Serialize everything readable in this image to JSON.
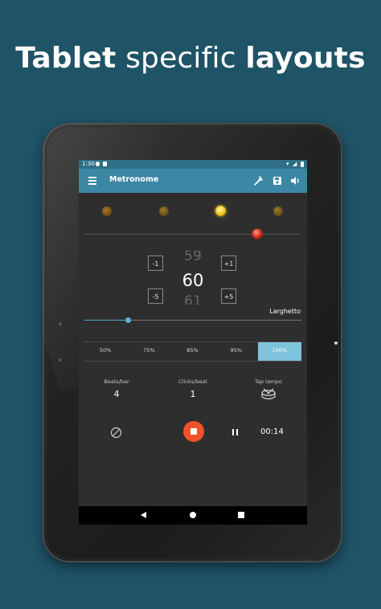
{
  "headline": {
    "bold_1": "Tablet",
    "light": " specific ",
    "bold_2": "layouts"
  },
  "status_bar": {
    "time": "1:30"
  },
  "toolbar": {
    "title": "Metronome"
  },
  "bpm": {
    "previous": "59",
    "current": "60",
    "next": "61"
  },
  "steppers": {
    "minus_one": "-1",
    "plus_one": "+1",
    "minus_five": "-5",
    "plus_five": "+5"
  },
  "tempo": {
    "name": "Larghetto",
    "slider_fraction": 0.2
  },
  "speed_options": [
    {
      "label": "50%"
    },
    {
      "label": "75%"
    },
    {
      "label": "85%"
    },
    {
      "label": "95%"
    },
    {
      "label": "100%",
      "active": true
    }
  ],
  "stats": {
    "beats_label": "Beats/bar",
    "beats_value": "4",
    "clicks_label": "Clicks/beat",
    "clicks_value": "1",
    "tap_label": "Tap tempo"
  },
  "player": {
    "elapsed": "00:14"
  },
  "colors": {
    "background": "#1f5366",
    "toolbar": "#3c87a4",
    "accent": "#7fc3dd",
    "stop": "#f0522b"
  }
}
